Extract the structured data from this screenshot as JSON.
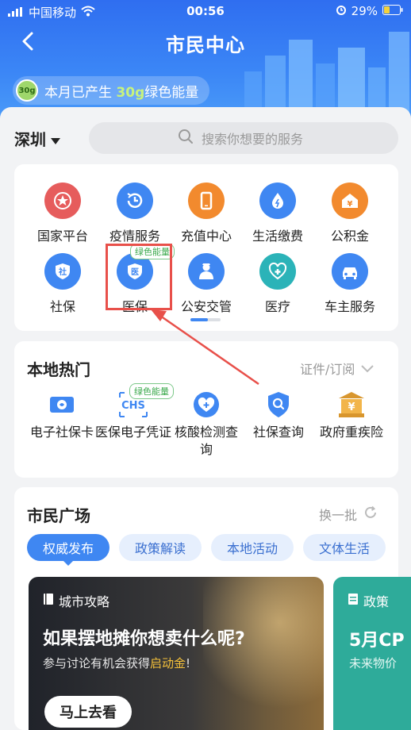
{
  "status": {
    "carrier": "中国移动",
    "time": "00:56",
    "battery": "29%"
  },
  "header": {
    "title": "市民中心"
  },
  "energy": {
    "coin": "30g",
    "prefix": "本月已产生",
    "amount": "30g",
    "suffix": "绿色能量"
  },
  "city": "深圳",
  "search": {
    "placeholder": "搜索你想要的服务"
  },
  "services": [
    {
      "label": "国家平台",
      "color": "#e65c5c",
      "icon": "national-emblem-icon"
    },
    {
      "label": "疫情服务",
      "color": "#3f87f2",
      "icon": "clock-refresh-icon"
    },
    {
      "label": "充值中心",
      "color": "#f28a2e",
      "icon": "phone-icon"
    },
    {
      "label": "生活缴费",
      "color": "#3f87f2",
      "icon": "water-drop-icon"
    },
    {
      "label": "公积金",
      "color": "#f28a2e",
      "icon": "house-yuan-icon"
    },
    {
      "label": "社保",
      "color": "#3f87f2",
      "icon": "shield-she-icon",
      "glyph": "社"
    },
    {
      "label": "医保",
      "color": "#3f87f2",
      "icon": "shield-yi-icon",
      "glyph": "医"
    },
    {
      "label": "公安交管",
      "color": "#3f87f2",
      "icon": "police-icon"
    },
    {
      "label": "医疗",
      "color": "#2bb3b8",
      "icon": "medical-heart-icon"
    },
    {
      "label": "车主服务",
      "color": "#3f87f2",
      "icon": "car-icon"
    }
  ],
  "green_badge": "绿色能量",
  "hot": {
    "title": "本地热门",
    "more": "证件/订阅",
    "items": [
      {
        "label": "电子社保卡",
        "icon": "social-card-icon"
      },
      {
        "label": "医保电子凭证",
        "icon": "chs-icon",
        "text": "CHS"
      },
      {
        "label": "核酸检测查询",
        "icon": "heart-plus-icon"
      },
      {
        "label": "社保查询",
        "icon": "shield-search-icon"
      },
      {
        "label": "政府重疾险",
        "icon": "bank-yuan-icon"
      }
    ]
  },
  "plaza": {
    "title": "市民广场",
    "more": "换一批",
    "tabs": [
      "权威发布",
      "政策解读",
      "本地活动",
      "文体生活"
    ],
    "banner": {
      "tag": "城市攻略",
      "headline": "如果摆地摊你想卖什么呢?",
      "sub_prefix": "参与讨论有机会获得",
      "sub_highlight": "启动金",
      "sub_suffix": "!",
      "button": "马上去看"
    },
    "banner2": {
      "tag": "政策",
      "headline": "5月CP",
      "sub": "未来物价"
    }
  }
}
